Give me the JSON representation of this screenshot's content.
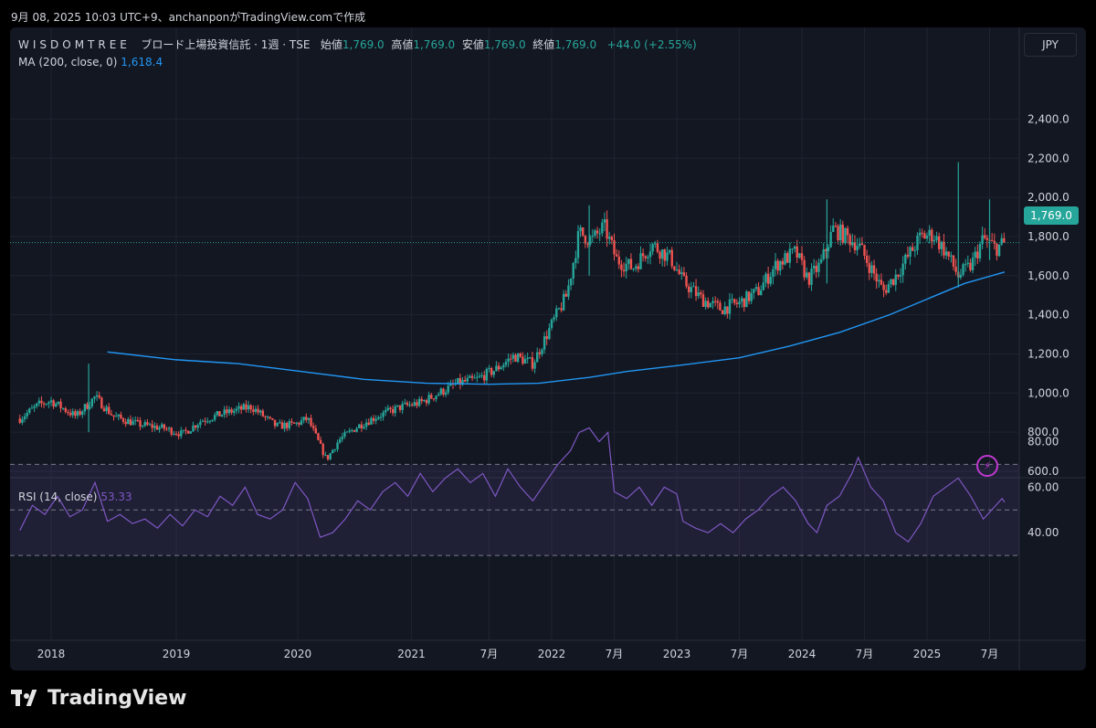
{
  "header": {
    "publish_line": "9月 08, 2025 10:03 UTC+9、anchanponがTradingView.comで作成"
  },
  "legend": {
    "ticker": "WISDOMTREE",
    "name": "ブロード上場投資信託 · 1週 · TSE",
    "open_label": "始値",
    "open": "1,769.0",
    "high_label": "高値",
    "high": "1,769.0",
    "low_label": "安値",
    "low": "1,769.0",
    "close_label": "終値",
    "close": "1,769.0",
    "change": "+44.0 (+2.55%)",
    "ma_label": "MA (200, close, 0)",
    "ma_value": "1,618.4",
    "rsi_label": "RSI (14, close)",
    "rsi_value": "53.33"
  },
  "currency_button": "JPY",
  "last_price_tag": "1,769.0",
  "brand": "TradingView",
  "colors": {
    "up": "#26a69a",
    "down": "#ef5350",
    "ma": "#2196f3",
    "rsi": "#7e57c2",
    "background": "#131722"
  },
  "icons": [
    "lightning-icon",
    "tradingview-logo"
  ],
  "chart_data": [
    {
      "type": "candlestick",
      "interval": "1 week",
      "title": "WISDOMTREE ブロード上場投資信託 · 1週 · TSE",
      "y_ticks": [
        "600.0",
        "800.0",
        "1,000.0",
        "1,200.0",
        "1,400.0",
        "1,600.0",
        "1,800.0",
        "2,000.0",
        "2,200.0",
        "2,400.0"
      ],
      "x_ticks": [
        "2018",
        "2019",
        "2020",
        "2021",
        "7月",
        "2022",
        "7月",
        "2023",
        "7月",
        "2024",
        "7月",
        "2025",
        "7月"
      ],
      "ylim": [
        480,
        2500
      ],
      "grid": true,
      "price_path": [
        [
          2017.75,
          870
        ],
        [
          2017.9,
          940
        ],
        [
          2018.0,
          960
        ],
        [
          2018.2,
          880
        ],
        [
          2018.35,
          980
        ],
        [
          2018.5,
          880
        ],
        [
          2018.7,
          840
        ],
        [
          2018.9,
          820
        ],
        [
          2019.05,
          790
        ],
        [
          2019.2,
          860
        ],
        [
          2019.4,
          900
        ],
        [
          2019.6,
          930
        ],
        [
          2019.8,
          830
        ],
        [
          2019.95,
          840
        ],
        [
          2020.05,
          870
        ],
        [
          2020.2,
          660
        ],
        [
          2020.3,
          760
        ],
        [
          2020.45,
          830
        ],
        [
          2020.6,
          880
        ],
        [
          2020.8,
          930
        ],
        [
          2020.95,
          950
        ],
        [
          2021.1,
          1000
        ],
        [
          2021.25,
          1050
        ],
        [
          2021.4,
          1070
        ],
        [
          2021.55,
          1120
        ],
        [
          2021.7,
          1190
        ],
        [
          2021.85,
          1150
        ],
        [
          2022.0,
          1350
        ],
        [
          2022.12,
          1500
        ],
        [
          2022.22,
          1820
        ],
        [
          2022.32,
          1780
        ],
        [
          2022.42,
          1850
        ],
        [
          2022.52,
          1680
        ],
        [
          2022.65,
          1640
        ],
        [
          2022.8,
          1760
        ],
        [
          2022.95,
          1690
        ],
        [
          2023.05,
          1570
        ],
        [
          2023.2,
          1480
        ],
        [
          2023.35,
          1430
        ],
        [
          2023.5,
          1460
        ],
        [
          2023.65,
          1520
        ],
        [
          2023.8,
          1660
        ],
        [
          2023.95,
          1720
        ],
        [
          2024.05,
          1580
        ],
        [
          2024.15,
          1660
        ],
        [
          2024.25,
          1840
        ],
        [
          2024.35,
          1800
        ],
        [
          2024.45,
          1760
        ],
        [
          2024.55,
          1640
        ],
        [
          2024.65,
          1520
        ],
        [
          2024.75,
          1600
        ],
        [
          2024.85,
          1700
        ],
        [
          2024.95,
          1800
        ],
        [
          2025.05,
          1810
        ],
        [
          2025.15,
          1720
        ],
        [
          2025.25,
          1600
        ],
        [
          2025.35,
          1650
        ],
        [
          2025.45,
          1790
        ],
        [
          2025.55,
          1740
        ],
        [
          2025.62,
          1769
        ]
      ],
      "wick_spikes": [
        [
          2018.3,
          1150,
          800
        ],
        [
          2022.3,
          1960,
          1600
        ],
        [
          2024.2,
          1990,
          1560
        ],
        [
          2025.25,
          2180,
          1540
        ],
        [
          2025.5,
          1990,
          1680
        ]
      ],
      "series": [
        {
          "name": "MA (200, close, 0)",
          "values": [
            [
              2018.45,
              1210
            ],
            [
              2019.0,
              1170
            ],
            [
              2019.5,
              1150
            ],
            [
              2020.0,
              1110
            ],
            [
              2020.5,
              1070
            ],
            [
              2021.0,
              1050
            ],
            [
              2021.5,
              1045
            ],
            [
              2021.9,
              1050
            ],
            [
              2022.3,
              1080
            ],
            [
              2022.6,
              1110
            ],
            [
              2023.0,
              1140
            ],
            [
              2023.5,
              1180
            ],
            [
              2023.9,
              1240
            ],
            [
              2024.3,
              1310
            ],
            [
              2024.7,
              1400
            ],
            [
              2025.0,
              1480
            ],
            [
              2025.3,
              1560
            ],
            [
              2025.62,
              1618.4
            ]
          ]
        }
      ]
    },
    {
      "type": "line",
      "name": "RSI (14, close)",
      "y_ticks": [
        "40.00",
        "60.00",
        "80.00"
      ],
      "ylim": [
        26,
        92
      ],
      "band": [
        30,
        70
      ],
      "middle": 50,
      "series": [
        {
          "name": "RSI (14, close)",
          "values": [
            [
              2017.75,
              41
            ],
            [
              2017.85,
              52
            ],
            [
              2017.95,
              48
            ],
            [
              2018.05,
              56
            ],
            [
              2018.15,
              47
            ],
            [
              2018.25,
              50
            ],
            [
              2018.35,
              62
            ],
            [
              2018.45,
              45
            ],
            [
              2018.55,
              48
            ],
            [
              2018.65,
              44
            ],
            [
              2018.75,
              46
            ],
            [
              2018.85,
              42
            ],
            [
              2018.95,
              48
            ],
            [
              2019.05,
              43
            ],
            [
              2019.15,
              50
            ],
            [
              2019.25,
              47
            ],
            [
              2019.35,
              56
            ],
            [
              2019.45,
              52
            ],
            [
              2019.55,
              60
            ],
            [
              2019.65,
              48
            ],
            [
              2019.75,
              46
            ],
            [
              2019.85,
              50
            ],
            [
              2019.95,
              62
            ],
            [
              2020.05,
              55
            ],
            [
              2020.15,
              38
            ],
            [
              2020.25,
              40
            ],
            [
              2020.35,
              46
            ],
            [
              2020.45,
              54
            ],
            [
              2020.55,
              50
            ],
            [
              2020.65,
              58
            ],
            [
              2020.75,
              62
            ],
            [
              2020.85,
              56
            ],
            [
              2020.95,
              66
            ],
            [
              2021.05,
              58
            ],
            [
              2021.15,
              64
            ],
            [
              2021.25,
              68
            ],
            [
              2021.35,
              62
            ],
            [
              2021.45,
              66
            ],
            [
              2021.55,
              56
            ],
            [
              2021.65,
              68
            ],
            [
              2021.75,
              60
            ],
            [
              2021.85,
              54
            ],
            [
              2021.95,
              62
            ],
            [
              2022.05,
              70
            ],
            [
              2022.15,
              76
            ],
            [
              2022.22,
              84
            ],
            [
              2022.3,
              86
            ],
            [
              2022.38,
              80
            ],
            [
              2022.45,
              84
            ],
            [
              2022.5,
              58
            ],
            [
              2022.6,
              55
            ],
            [
              2022.7,
              60
            ],
            [
              2022.8,
              52
            ],
            [
              2022.9,
              60
            ],
            [
              2023.0,
              57
            ],
            [
              2023.05,
              45
            ],
            [
              2023.15,
              42
            ],
            [
              2023.25,
              40
            ],
            [
              2023.35,
              44
            ],
            [
              2023.45,
              40
            ],
            [
              2023.55,
              46
            ],
            [
              2023.65,
              50
            ],
            [
              2023.75,
              56
            ],
            [
              2023.85,
              60
            ],
            [
              2023.95,
              54
            ],
            [
              2024.05,
              44
            ],
            [
              2024.12,
              40
            ],
            [
              2024.2,
              52
            ],
            [
              2024.3,
              56
            ],
            [
              2024.4,
              66
            ],
            [
              2024.45,
              73
            ],
            [
              2024.55,
              60
            ],
            [
              2024.65,
              54
            ],
            [
              2024.75,
              40
            ],
            [
              2024.85,
              36
            ],
            [
              2024.95,
              44
            ],
            [
              2025.05,
              56
            ],
            [
              2025.15,
              60
            ],
            [
              2025.25,
              64
            ],
            [
              2025.35,
              56
            ],
            [
              2025.45,
              46
            ],
            [
              2025.55,
              52
            ],
            [
              2025.6,
              55
            ],
            [
              2025.62,
              53.33
            ]
          ]
        }
      ]
    }
  ]
}
